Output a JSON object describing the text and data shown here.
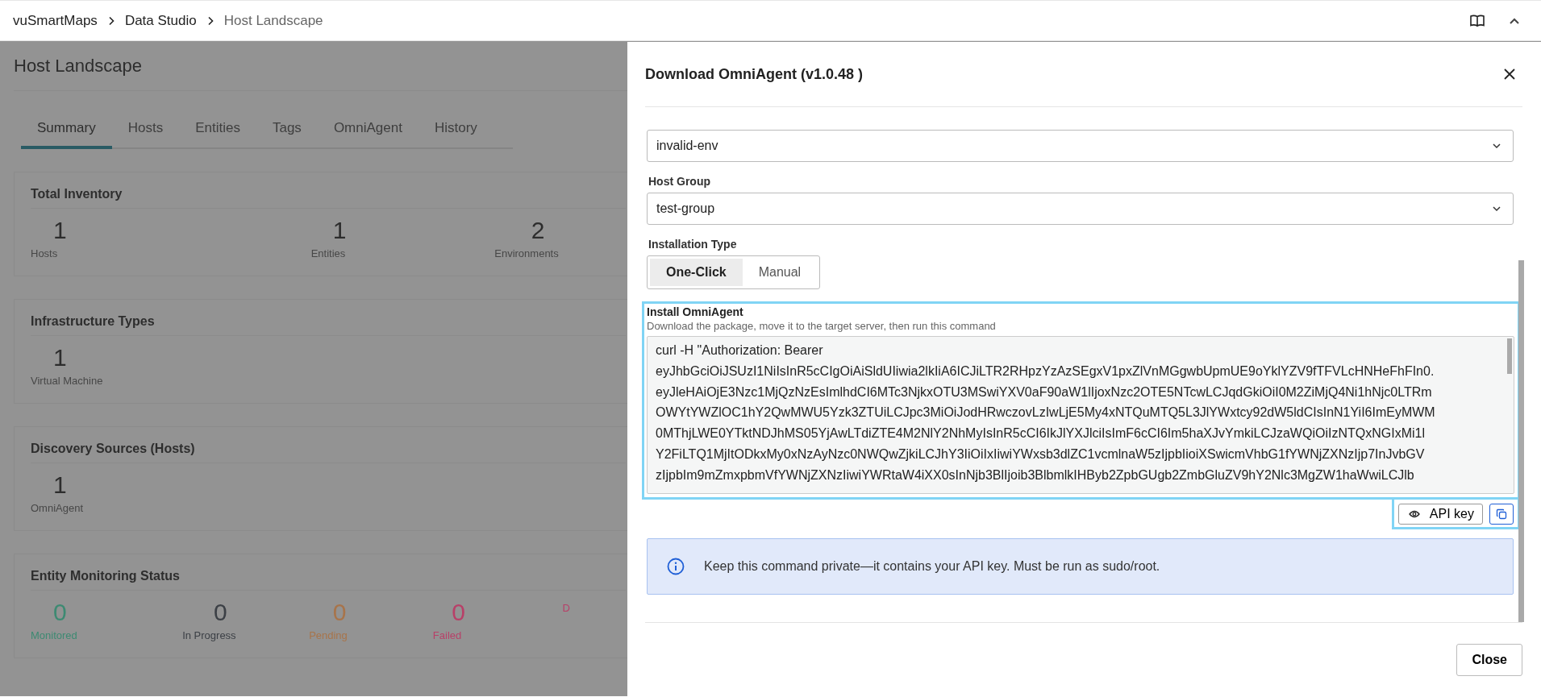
{
  "breadcrumb": [
    {
      "label": "vuSmartMaps",
      "current": false
    },
    {
      "label": "Data Studio",
      "current": false
    },
    {
      "label": "Host Landscape",
      "current": true
    }
  ],
  "page": {
    "title": "Host Landscape",
    "tabs": [
      {
        "label": "Summary",
        "selected": true
      },
      {
        "label": "Hosts",
        "selected": false
      },
      {
        "label": "Entities",
        "selected": false
      },
      {
        "label": "Tags",
        "selected": false
      },
      {
        "label": "OmniAgent",
        "selected": false
      },
      {
        "label": "History",
        "selected": false
      }
    ],
    "cards": [
      {
        "title": "Total Inventory",
        "stats": [
          {
            "value": "1",
            "label": "Hosts"
          },
          {
            "value": "1",
            "label": "Entities"
          },
          {
            "value": "2",
            "label": "Environments"
          }
        ]
      },
      {
        "title": "Infrastructure Types",
        "stats": [
          {
            "value": "1",
            "label": "Virtual Machine"
          }
        ]
      },
      {
        "title": "Discovery Sources (Hosts)",
        "stats": [
          {
            "value": "1",
            "label": "OmniAgent"
          }
        ]
      },
      {
        "title": "Entity Monitoring Status",
        "stats": [
          {
            "value": "0",
            "label": "Monitored",
            "color": "#3d8a72"
          },
          {
            "value": "0",
            "label": "In Progress",
            "color": "#3c4046"
          },
          {
            "value": "0",
            "label": "Pending",
            "color": "#a8744a"
          },
          {
            "value": "0",
            "label": "Failed",
            "color": "#b84068"
          },
          {
            "label": "D",
            "color": "#b84068"
          }
        ]
      }
    ]
  },
  "drawer": {
    "title": "Download OmniAgent (v1.0.48 )",
    "environment": {
      "value": "invalid-env"
    },
    "host_group": {
      "label": "Host Group",
      "value": "test-group"
    },
    "installation_type": {
      "label": "Installation Type",
      "options": [
        {
          "label": "One-Click",
          "selected": true
        },
        {
          "label": "Manual",
          "selected": false
        }
      ]
    },
    "install": {
      "title": "Install OmniAgent",
      "description": "Download the package, move it to the target server, then run this command",
      "command_lines": [
        "curl -H \"Authorization: Bearer",
        "eyJhbGciOiJSUzI1NiIsInR5cCIgOiAiSldUIiwia2lkIiA6ICJiLTR2RHpzYzAzSEgxV1pxZlVnMGgwbUpmUE9oYklYZV9fTFVLcHNHeFhFIn0.",
        "eyJleHAiOjE3Nzc1MjQzNzEsImlhdCI6MTc3NjkxOTU3MSwiYXV0aF90aW1lIjoxNzc2OTE5NTcwLCJqdGkiOiI0M2ZiMjQ4Ni1hNjc0LTRm",
        "OWYtYWZlOC1hY2QwMWU5Yzk3ZTUiLCJpc3MiOiJodHRwczovLzIwLjE5My4xNTQuMTQ5L3JlYWxtcy92dW5ldCIsInN1YiI6ImEyMWM",
        "0MThjLWE0YTktNDJhMS05YjAwLTdiZTE4M2NlY2NhMyIsInR5cCI6IkJlYXJlciIsImF6cCI6Im5haXJvYmkiLCJzaWQiOiIzNTQxNGIxMi1l",
        "Y2FiLTQ1MjItODkxMy0xNzAyNzc0NWQwZjkiLCJhY3IiOiIxIiwiYWxsb3dlZC1vcmlnaW5zIjpbIioiXSwicmVhbG1fYWNjZXNzIjp7InJvbGV",
        "zIjpbIm9mZmxpbmVfYWNjZXNzIiwiYWRtaW4iXX0sInNjb3BlIjoib3BlbmlkIHByb2ZpbGUgb2ZmbGluZV9hY2Nlc3MgZW1haWwiLCJlb"
      ],
      "api_key_button": "API key"
    },
    "notice": "Keep this command private—it contains your API key. Must be run as sudo/root.",
    "close_button": "Close"
  }
}
